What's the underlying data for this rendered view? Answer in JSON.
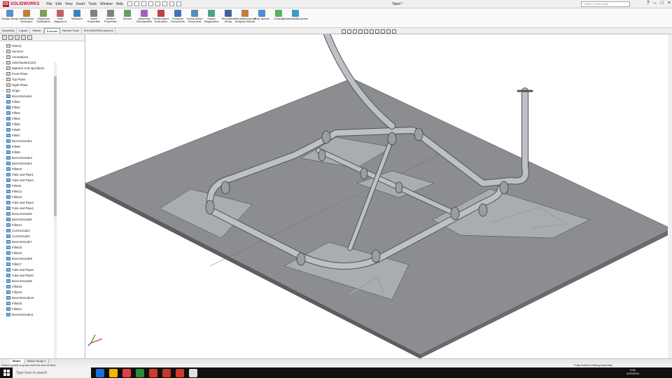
{
  "app": {
    "brand": "SOLIDWORKS",
    "menus": [
      "File",
      "Edit",
      "View",
      "Insert",
      "Tools",
      "Window",
      "Help"
    ],
    "document_title": "Tabel *",
    "search_placeholder": "Search Commands"
  },
  "ribbon": {
    "items": [
      {
        "label": "Design Study",
        "color": "#5a8fd0"
      },
      {
        "label": "Interference Detection",
        "color": "#c08030"
      },
      {
        "label": "Clearance Verification",
        "color": "#7aa050"
      },
      {
        "label": "Hole Alignment",
        "color": "#c06060"
      },
      {
        "label": "Measure",
        "color": "#3f80c0"
      },
      {
        "label": "Mass Properties",
        "color": "#808080"
      },
      {
        "label": "Section Properties",
        "color": "#808080"
      },
      {
        "label": "Sensor",
        "color": "#60a060"
      },
      {
        "label": "Assembly Visualization",
        "color": "#a060c0"
      },
      {
        "label": "Performance Evaluation",
        "color": "#c04040"
      },
      {
        "label": "Compare Documents",
        "color": "#4070c0"
      },
      {
        "label": "Check Active Document",
        "color": "#5090c0"
      },
      {
        "label": "Import Diagnostics",
        "color": "#50a090"
      },
      {
        "label": "Simulation Setup",
        "color": "#4060a0"
      },
      {
        "label": "SimulationXpress Analysis Wizard",
        "color": "#c08040"
      },
      {
        "label": "Flow Xpress",
        "color": "#4a90d0"
      },
      {
        "label": "Costing",
        "color": "#60b060"
      },
      {
        "label": "SustainabilityXpress",
        "color": "#3a9ad0"
      }
    ]
  },
  "command_tabs": [
    "Assembly",
    "Layout",
    "Sketch",
    "Evaluate",
    "Render Tools",
    "SOLIDWORKS Add-Ins"
  ],
  "active_command_tab": "Evaluate",
  "feature_tree": {
    "items": [
      {
        "label": "History",
        "kind": "feat"
      },
      {
        "label": "Sensors",
        "kind": "feat"
      },
      {
        "label": "Annotations",
        "kind": "feat"
      },
      {
        "label": "Solid Bodies(112)",
        "kind": "feat"
      },
      {
        "label": "Material <not specified>",
        "kind": "feat"
      },
      {
        "label": "Front Plane",
        "kind": "feat"
      },
      {
        "label": "Top Plane",
        "kind": "feat"
      },
      {
        "label": "Right Plane",
        "kind": "feat"
      },
      {
        "label": "Origin",
        "kind": "feat"
      },
      {
        "label": "Boss-Extrude1",
        "kind": "part"
      },
      {
        "label": "Fillet1",
        "kind": "part"
      },
      {
        "label": "Fillet2",
        "kind": "part"
      },
      {
        "label": "Fillet3",
        "kind": "part"
      },
      {
        "label": "Fillet4",
        "kind": "part"
      },
      {
        "label": "Fillet5",
        "kind": "part"
      },
      {
        "label": "Fillet6",
        "kind": "part"
      },
      {
        "label": "Fillet7",
        "kind": "part"
      },
      {
        "label": "Boss-Extrude2",
        "kind": "part"
      },
      {
        "label": "Fillet8",
        "kind": "part"
      },
      {
        "label": "Fillet9",
        "kind": "part"
      },
      {
        "label": "Boss-Extrude3",
        "kind": "part"
      },
      {
        "label": "Boss-Extrude4",
        "kind": "part"
      },
      {
        "label": "Fillet10",
        "kind": "part"
      },
      {
        "label": "Tube and Pipe1",
        "kind": "part"
      },
      {
        "label": "Tube and Pipe2",
        "kind": "part"
      },
      {
        "label": "Fillet11",
        "kind": "part"
      },
      {
        "label": "Fillet12",
        "kind": "part"
      },
      {
        "label": "Fillet13",
        "kind": "part"
      },
      {
        "label": "Tube and Pipe3",
        "kind": "part"
      },
      {
        "label": "Tube and Pipe4",
        "kind": "part"
      },
      {
        "label": "Boss-Extrude5",
        "kind": "part"
      },
      {
        "label": "Boss-Extrude6",
        "kind": "part"
      },
      {
        "label": "Fillet14",
        "kind": "part"
      },
      {
        "label": "Cut-Extrude1",
        "kind": "part"
      },
      {
        "label": "Cut-Extrude2",
        "kind": "part"
      },
      {
        "label": "Boss-Extrude7",
        "kind": "part"
      },
      {
        "label": "Fillet15",
        "kind": "part"
      },
      {
        "label": "Fillet16",
        "kind": "part"
      },
      {
        "label": "Boss-Extrude8",
        "kind": "part"
      },
      {
        "label": "Fillet17",
        "kind": "part"
      },
      {
        "label": "Tube and Pipe5",
        "kind": "part"
      },
      {
        "label": "Tube and Pipe6",
        "kind": "part"
      },
      {
        "label": "Boss-Extrude9",
        "kind": "part"
      },
      {
        "label": "Fillet18",
        "kind": "part"
      },
      {
        "label": "Fillet19",
        "kind": "part"
      },
      {
        "label": "Boss-Extrude10",
        "kind": "part"
      },
      {
        "label": "Fillet20",
        "kind": "part"
      },
      {
        "label": "Fillet21",
        "kind": "part"
      },
      {
        "label": "Boss-Extrude11",
        "kind": "part"
      }
    ]
  },
  "bottom_tabs": [
    "Model",
    "Motion Study 1"
  ],
  "active_bottom_tab": "Model",
  "status": {
    "left": "Select a point or press enter for end of lines",
    "right": "Fully Defined   Editing Assembly"
  },
  "taskbar": {
    "search_placeholder": "Type here to search",
    "app_colors": [
      "#1e6fd9",
      "#f5b400",
      "#e04040",
      "#2a8a3a",
      "#d13a2a",
      "#c0392b",
      "#d13a2a",
      "#e0e0e0"
    ],
    "time": "9:55",
    "date": "4/23/2020"
  },
  "colors": {
    "viewport_bg": "#ffffff",
    "plate": "#8a8c90",
    "tube": "#b9bcc1",
    "accent": "#c8102e"
  }
}
